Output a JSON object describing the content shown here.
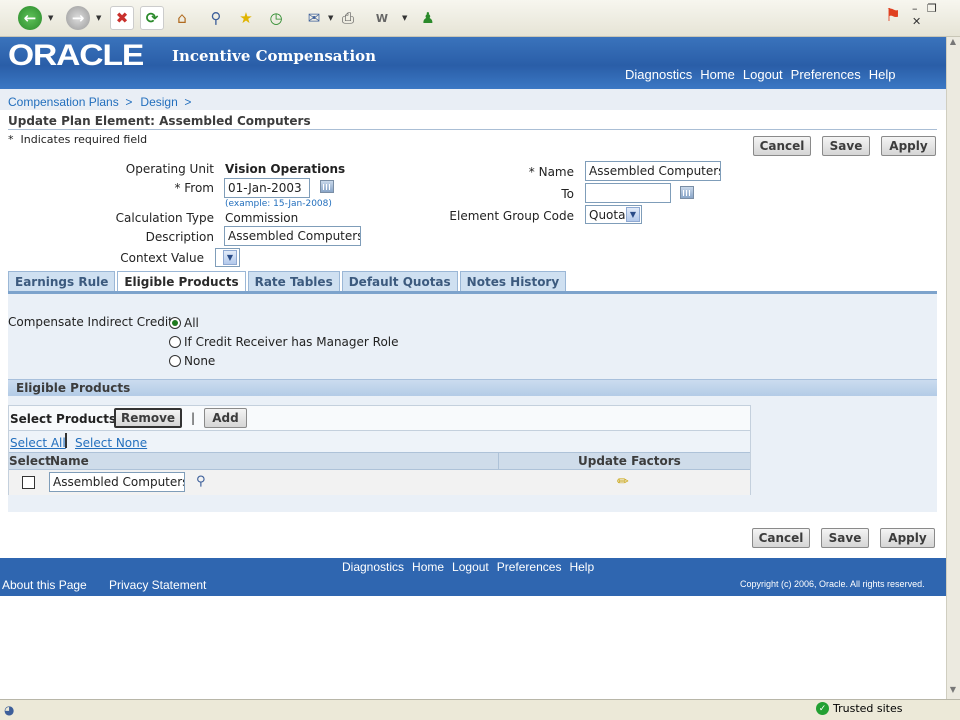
{
  "browser": {
    "toolbar_icons": [
      "back-icon",
      "forward-icon",
      "stop-icon",
      "refresh-icon",
      "home-icon",
      "search-icon",
      "favorites-icon",
      "history-icon",
      "mail-icon",
      "print-icon",
      "edit-icon",
      "messenger-icon"
    ],
    "status_zone": "Trusted sites"
  },
  "header": {
    "logo": "ORACLE",
    "product": "Incentive Compensation",
    "global_links": [
      "Diagnostics",
      "Home",
      "Logout",
      "Preferences",
      "Help"
    ]
  },
  "breadcrumbs": [
    "Compensation Plans  >",
    "Design  >"
  ],
  "page": {
    "title": "Update Plan Element: Assembled Computers",
    "required_note": "*  Indicates required field"
  },
  "buttons": {
    "cancel": "Cancel",
    "save": "Save",
    "apply": "Apply"
  },
  "form": {
    "operating_unit_label": "Operating Unit",
    "operating_unit_value": "Vision Operations",
    "from_label": "* From",
    "from_value": "01-Jan-2003",
    "from_example": "(example: 15-Jan-2008)",
    "calc_type_label": "Calculation Type",
    "calc_type_value": "Commission",
    "description_label": "Description",
    "description_value": "Assembled Computers",
    "context_label": "Context Value",
    "context_value": "",
    "name_label": "* Name",
    "name_value": "Assembled Computers",
    "to_label": "To",
    "to_value": "",
    "group_label": "Element Group Code",
    "group_value": "Quota"
  },
  "tabs": [
    "Earnings Rule",
    "Eligible Products",
    "Rate Tables",
    "Default Quotas",
    "Notes History"
  ],
  "active_tab": "Eligible Products",
  "compensate": {
    "label": "Compensate Indirect Credit",
    "options": [
      "All",
      "If Credit Receiver has Manager Role",
      "None"
    ],
    "selected": "All"
  },
  "eligible": {
    "section_title": "Eligible Products",
    "select_products_label": "Select Products:",
    "remove_button": "Remove",
    "separator": "|",
    "add_button": "Add",
    "select_all": "Select All",
    "select_none": "Select None",
    "columns": {
      "select": "Select",
      "name": "Name",
      "update_factors": "Update Factors"
    },
    "rows": [
      {
        "name": "Assembled Computers",
        "checked": false
      }
    ]
  },
  "footer": {
    "links": [
      "Diagnostics",
      "Home",
      "Logout",
      "Preferences",
      "Help"
    ],
    "about": "About this Page",
    "privacy": "Privacy Statement",
    "copyright": "Copyright (c) 2006, Oracle. All rights reserved."
  },
  "colors": {
    "banner": "#2a5ea8",
    "link": "#236fbd",
    "tab": "#cfe0f1",
    "footer": "#2f66b0"
  }
}
